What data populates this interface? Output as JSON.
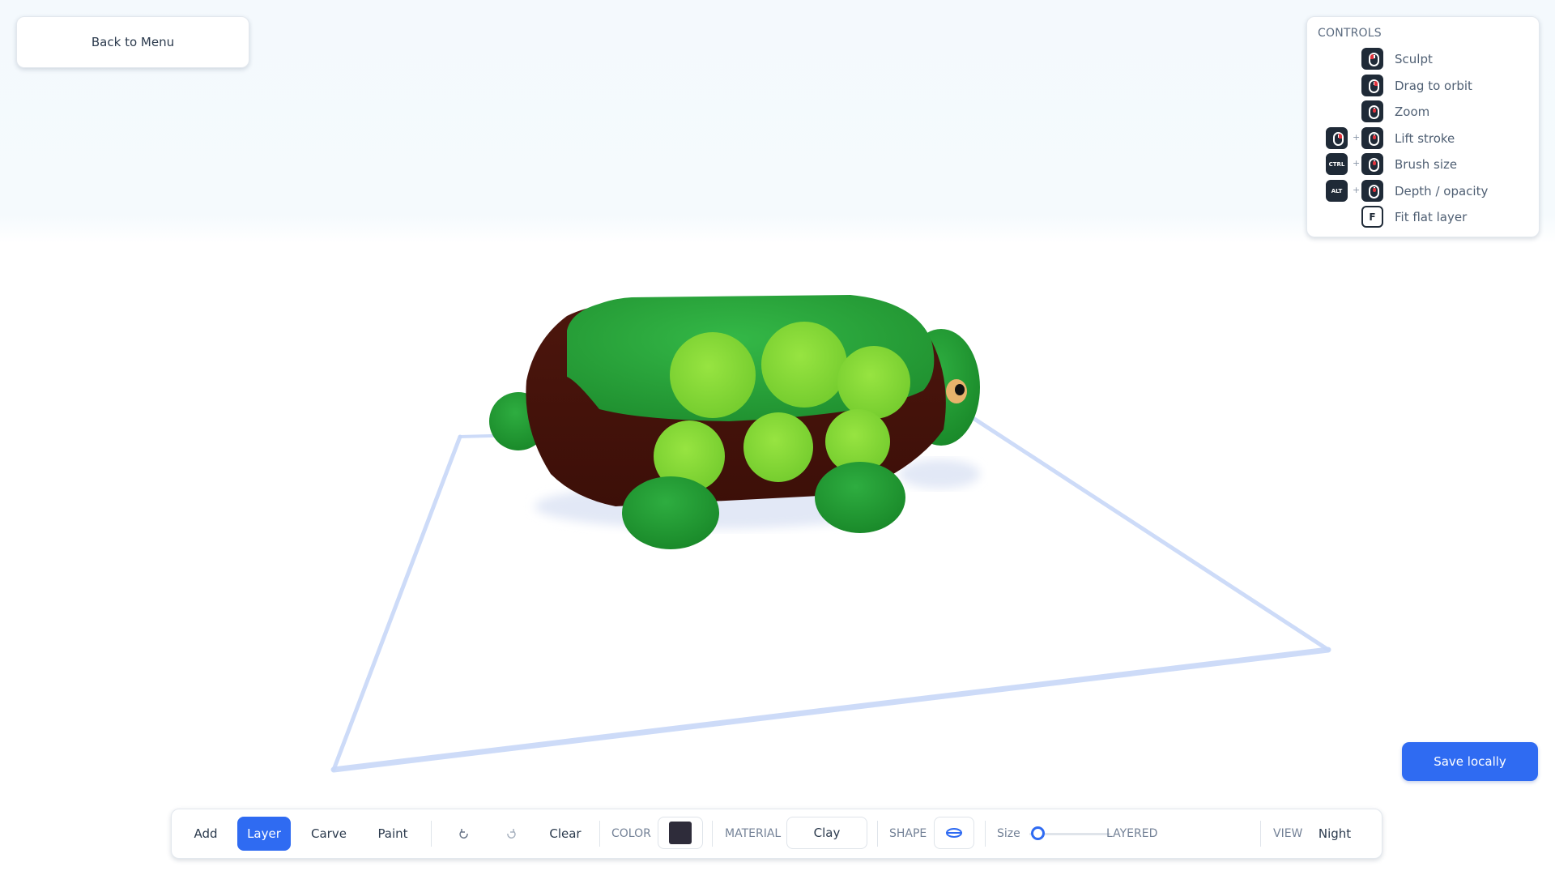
{
  "nav": {
    "back_label": "Back to Menu"
  },
  "controls": {
    "title": "CONTROLS",
    "items": [
      {
        "label": "Sculpt",
        "keys": [
          "left-click-mouse-icon"
        ]
      },
      {
        "label": "Drag to orbit",
        "keys": [
          "right-click-mouse-icon"
        ]
      },
      {
        "label": "Zoom",
        "keys": [
          "scroll-wheel-mouse-icon"
        ]
      },
      {
        "label": "Lift stroke",
        "keys": [
          "right-click-mouse-icon",
          "scroll-wheel-mouse-icon"
        ]
      },
      {
        "label": "Brush size",
        "keys": [
          "CTRL",
          "scroll-wheel-mouse-icon"
        ]
      },
      {
        "label": "Depth / opacity",
        "keys": [
          "ALT",
          "scroll-wheel-mouse-icon"
        ]
      },
      {
        "label": "Fit flat layer",
        "keys": [
          "F"
        ]
      }
    ]
  },
  "toolbar": {
    "tools": [
      "Add",
      "Layer",
      "Carve",
      "Paint"
    ],
    "active_tool": "Layer",
    "undo_icon": "undo-icon",
    "redo_icon": "redo-icon",
    "clear_label": "Clear",
    "color_label": "COLOR",
    "color_value": "#2e2c3a",
    "material_label": "MATERIAL",
    "material_value": "Clay",
    "shape_label": "SHAPE",
    "shape_icon": "disc-shape-icon",
    "size_label": "Size",
    "size_value": 0.02,
    "mode_label": "LAYERED",
    "view_label": "VIEW",
    "view_value": "Night"
  },
  "save_label": "Save locally",
  "colors": {
    "accent": "#2f6bf2",
    "shell_green": "#2bab3c",
    "spot_green": "#8bdc3a",
    "body_brown": "#5a1a10",
    "grid_outline": "#c8d8f8"
  }
}
